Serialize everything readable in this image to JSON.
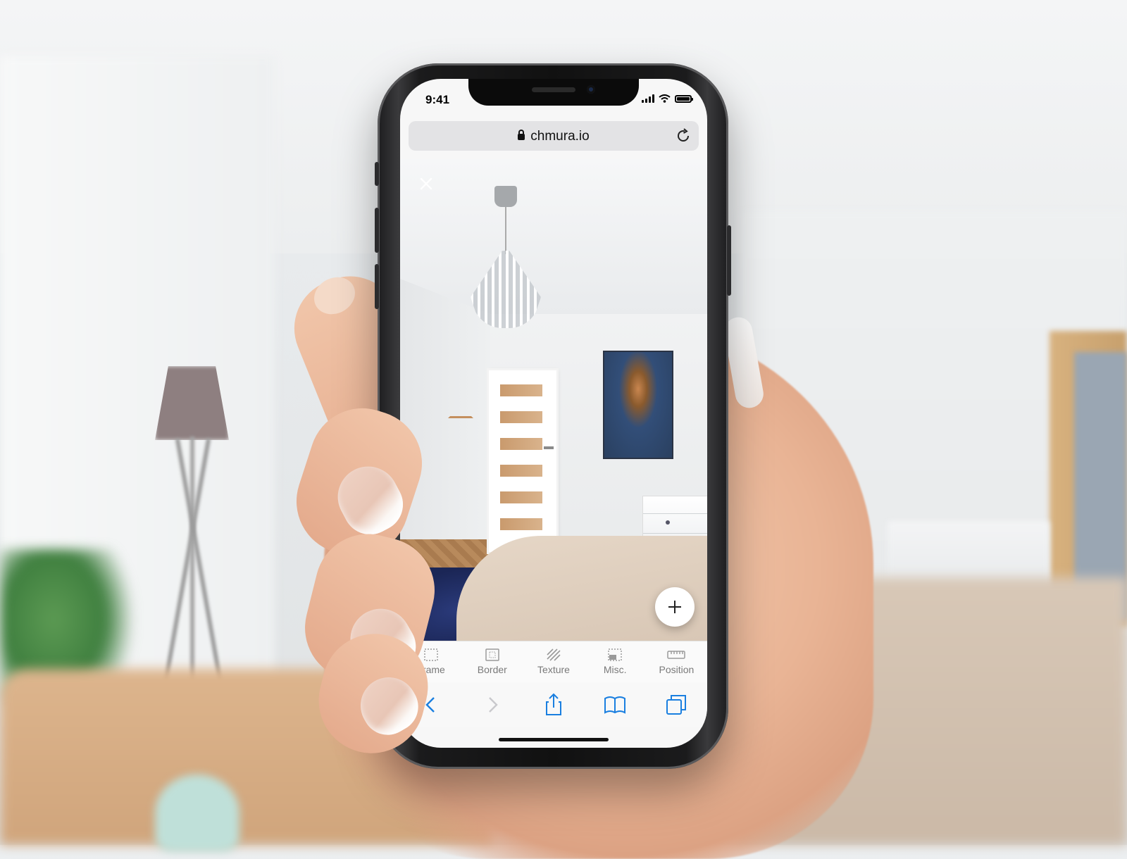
{
  "status_bar": {
    "time": "9:41"
  },
  "browser": {
    "url": "chmura.io"
  },
  "tool_tabs": [
    {
      "label": "Frame",
      "icon": "frame-icon"
    },
    {
      "label": "Border",
      "icon": "border-icon"
    },
    {
      "label": "Texture",
      "icon": "texture-icon"
    },
    {
      "label": "Misc.",
      "icon": "misc-icon"
    },
    {
      "label": "Position",
      "icon": "ruler-icon"
    }
  ],
  "safari_toolbar": {
    "icons": [
      "back-icon",
      "forward-icon",
      "share-icon",
      "bookmarks-icon",
      "tabs-icon"
    ]
  },
  "colors": {
    "accent": "#1a7fe0",
    "tab_label": "#7a7a7a",
    "url_bar": "#e3e3e5"
  }
}
